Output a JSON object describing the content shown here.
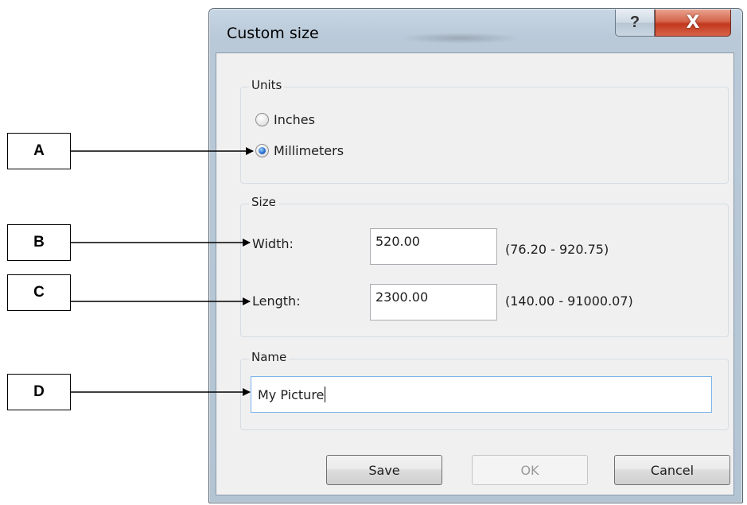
{
  "callouts": {
    "a": "A",
    "b": "B",
    "c": "C",
    "d": "D"
  },
  "dialog": {
    "title": "Custom size",
    "help_icon": "?",
    "close_icon": "X",
    "units": {
      "legend": "Units",
      "options": [
        {
          "label": "Inches",
          "checked": false
        },
        {
          "label": "Millimeters",
          "checked": true
        }
      ]
    },
    "size": {
      "legend": "Size",
      "width_label": "Width:",
      "width_value": "520.00",
      "width_range": "(76.20 - 920.75)",
      "length_label": "Length:",
      "length_value": "2300.00",
      "length_range": "(140.00 - 91000.07)"
    },
    "name": {
      "legend": "Name",
      "value": "My Picture"
    },
    "buttons": {
      "save": "Save",
      "ok": "OK",
      "cancel": "Cancel"
    }
  }
}
